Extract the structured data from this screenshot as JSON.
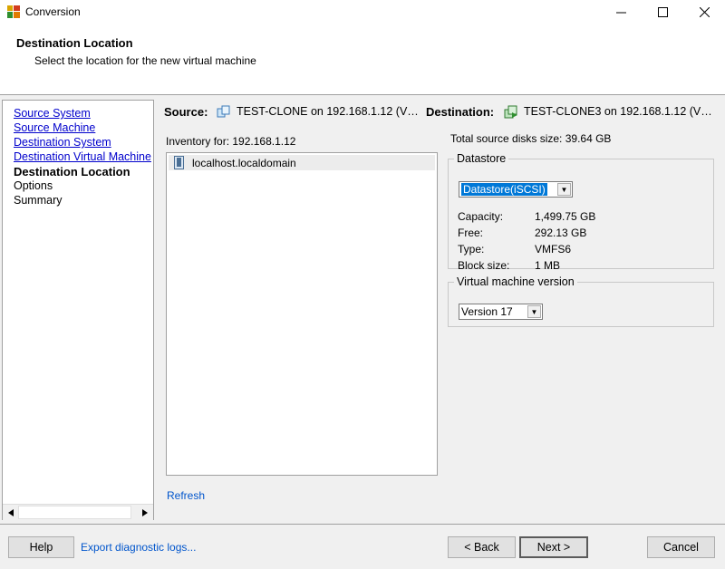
{
  "window": {
    "title": "Conversion",
    "minimize": "—",
    "maximize": "☐",
    "close": "✕"
  },
  "header": {
    "title": "Destination Location",
    "subtitle": "Select the location for the new virtual machine"
  },
  "nav": {
    "items": [
      {
        "label": "Source System",
        "state": "link"
      },
      {
        "label": "Source Machine",
        "state": "link"
      },
      {
        "label": "Destination System",
        "state": "link"
      },
      {
        "label": "Destination Virtual Machine",
        "state": "link"
      },
      {
        "label": "Destination Location",
        "state": "current"
      },
      {
        "label": "Options",
        "state": "plain"
      },
      {
        "label": "Summary",
        "state": "plain"
      }
    ]
  },
  "summary_line": {
    "source_label": "Source:",
    "source_value": "TEST-CLONE on 192.168.1.12 (V…",
    "dest_label": "Destination:",
    "dest_value": "TEST-CLONE3 on 192.168.1.12 (V…"
  },
  "inventory": {
    "label": "Inventory for:  192.168.1.12",
    "items": [
      "localhost.localdomain"
    ],
    "refresh": "Refresh"
  },
  "disk": {
    "total_label": "Total source disks size: ",
    "total_value": "39.64 GB"
  },
  "datastore": {
    "legend": "Datastore",
    "selected": "Datastore(iSCSI)",
    "capacity_label": "Capacity:",
    "capacity_value": "1,499.75 GB",
    "free_label": "Free:",
    "free_value": "292.13 GB",
    "type_label": "Type:",
    "type_value": "VMFS6",
    "block_label": "Block size:",
    "block_value": "1 MB"
  },
  "vm_version": {
    "legend": "Virtual machine version",
    "selected": "Version 17"
  },
  "footer": {
    "help": "Help",
    "export": "Export diagnostic logs...",
    "back": "< Back",
    "next": "Next >",
    "cancel": "Cancel"
  },
  "colors": {
    "link": "#0000cc",
    "selection": "#0078d7"
  }
}
